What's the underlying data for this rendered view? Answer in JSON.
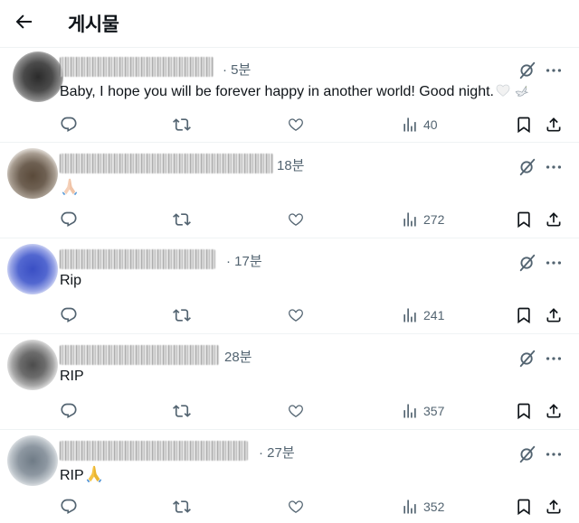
{
  "header": {
    "title": "게시물"
  },
  "posts": [
    {
      "time": "5분",
      "prefix_dot": true,
      "text": "Baby, I hope you will be forever happy in another world! Good night.",
      "emoji": [
        "white-heart",
        "dove"
      ],
      "views": "40"
    },
    {
      "time": "18분",
      "prefix_dot": false,
      "text": "",
      "emoji": [
        "folded-hands-light"
      ],
      "views": "272"
    },
    {
      "time": "17분",
      "prefix_dot": true,
      "text": "Rip",
      "emoji": [],
      "views": "241"
    },
    {
      "time": "28분",
      "prefix_dot": false,
      "text": "RIP",
      "emoji": [],
      "views": "357"
    },
    {
      "time": "27분",
      "prefix_dot": true,
      "text": "RIP",
      "emoji": [
        "folded-hands"
      ],
      "views": "352"
    }
  ],
  "icons": {
    "back": "arrow-left-icon",
    "grok": "grok-icon",
    "more": "more-icon",
    "reply": "reply-icon",
    "repost": "repost-icon",
    "like": "heart-icon",
    "views": "views-icon",
    "bookmark": "bookmark-icon",
    "share": "share-icon"
  },
  "colors": {
    "text": "#0f1419",
    "muted": "#536471",
    "divider": "#eff3f4"
  }
}
